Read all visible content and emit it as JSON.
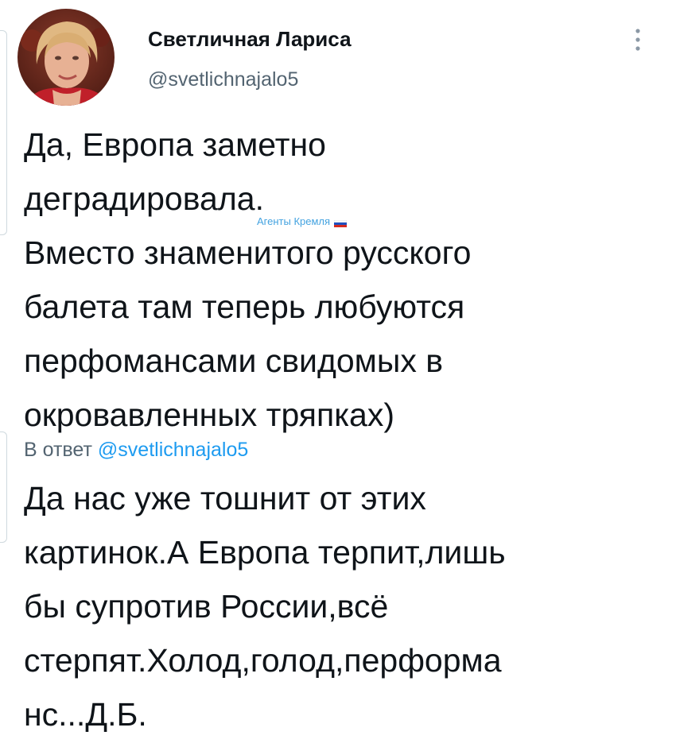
{
  "tweet": {
    "author": {
      "display_name": "Светличная Лариса",
      "handle": "@svetlichnajalo5",
      "avatar": "user-avatar-photo"
    },
    "text": "Да, Европа заметно\nдеградировала.\nВместо знаменитого русского\nбалета там теперь любуются\nперфомансами свидомых в\nокровавленных тряпках)",
    "menu_icon": "more-vertical-icon"
  },
  "watermark": {
    "text": "Агенты Кремля",
    "icon": "russian-flag-icon"
  },
  "reply": {
    "prefix": "В ответ",
    "mention": "@svetlichnajalo5",
    "text": "Да нас уже тошнит от этих\nкартинок.А Европа терпит,лишь\nбы супротив России,всё\nстерпят.Холод,голод,перформа\nнс...Д.Б."
  },
  "colors": {
    "text": "#0f1419",
    "secondary": "#536471",
    "link": "#1d9bf0",
    "thread_line": "#cfd9de"
  }
}
